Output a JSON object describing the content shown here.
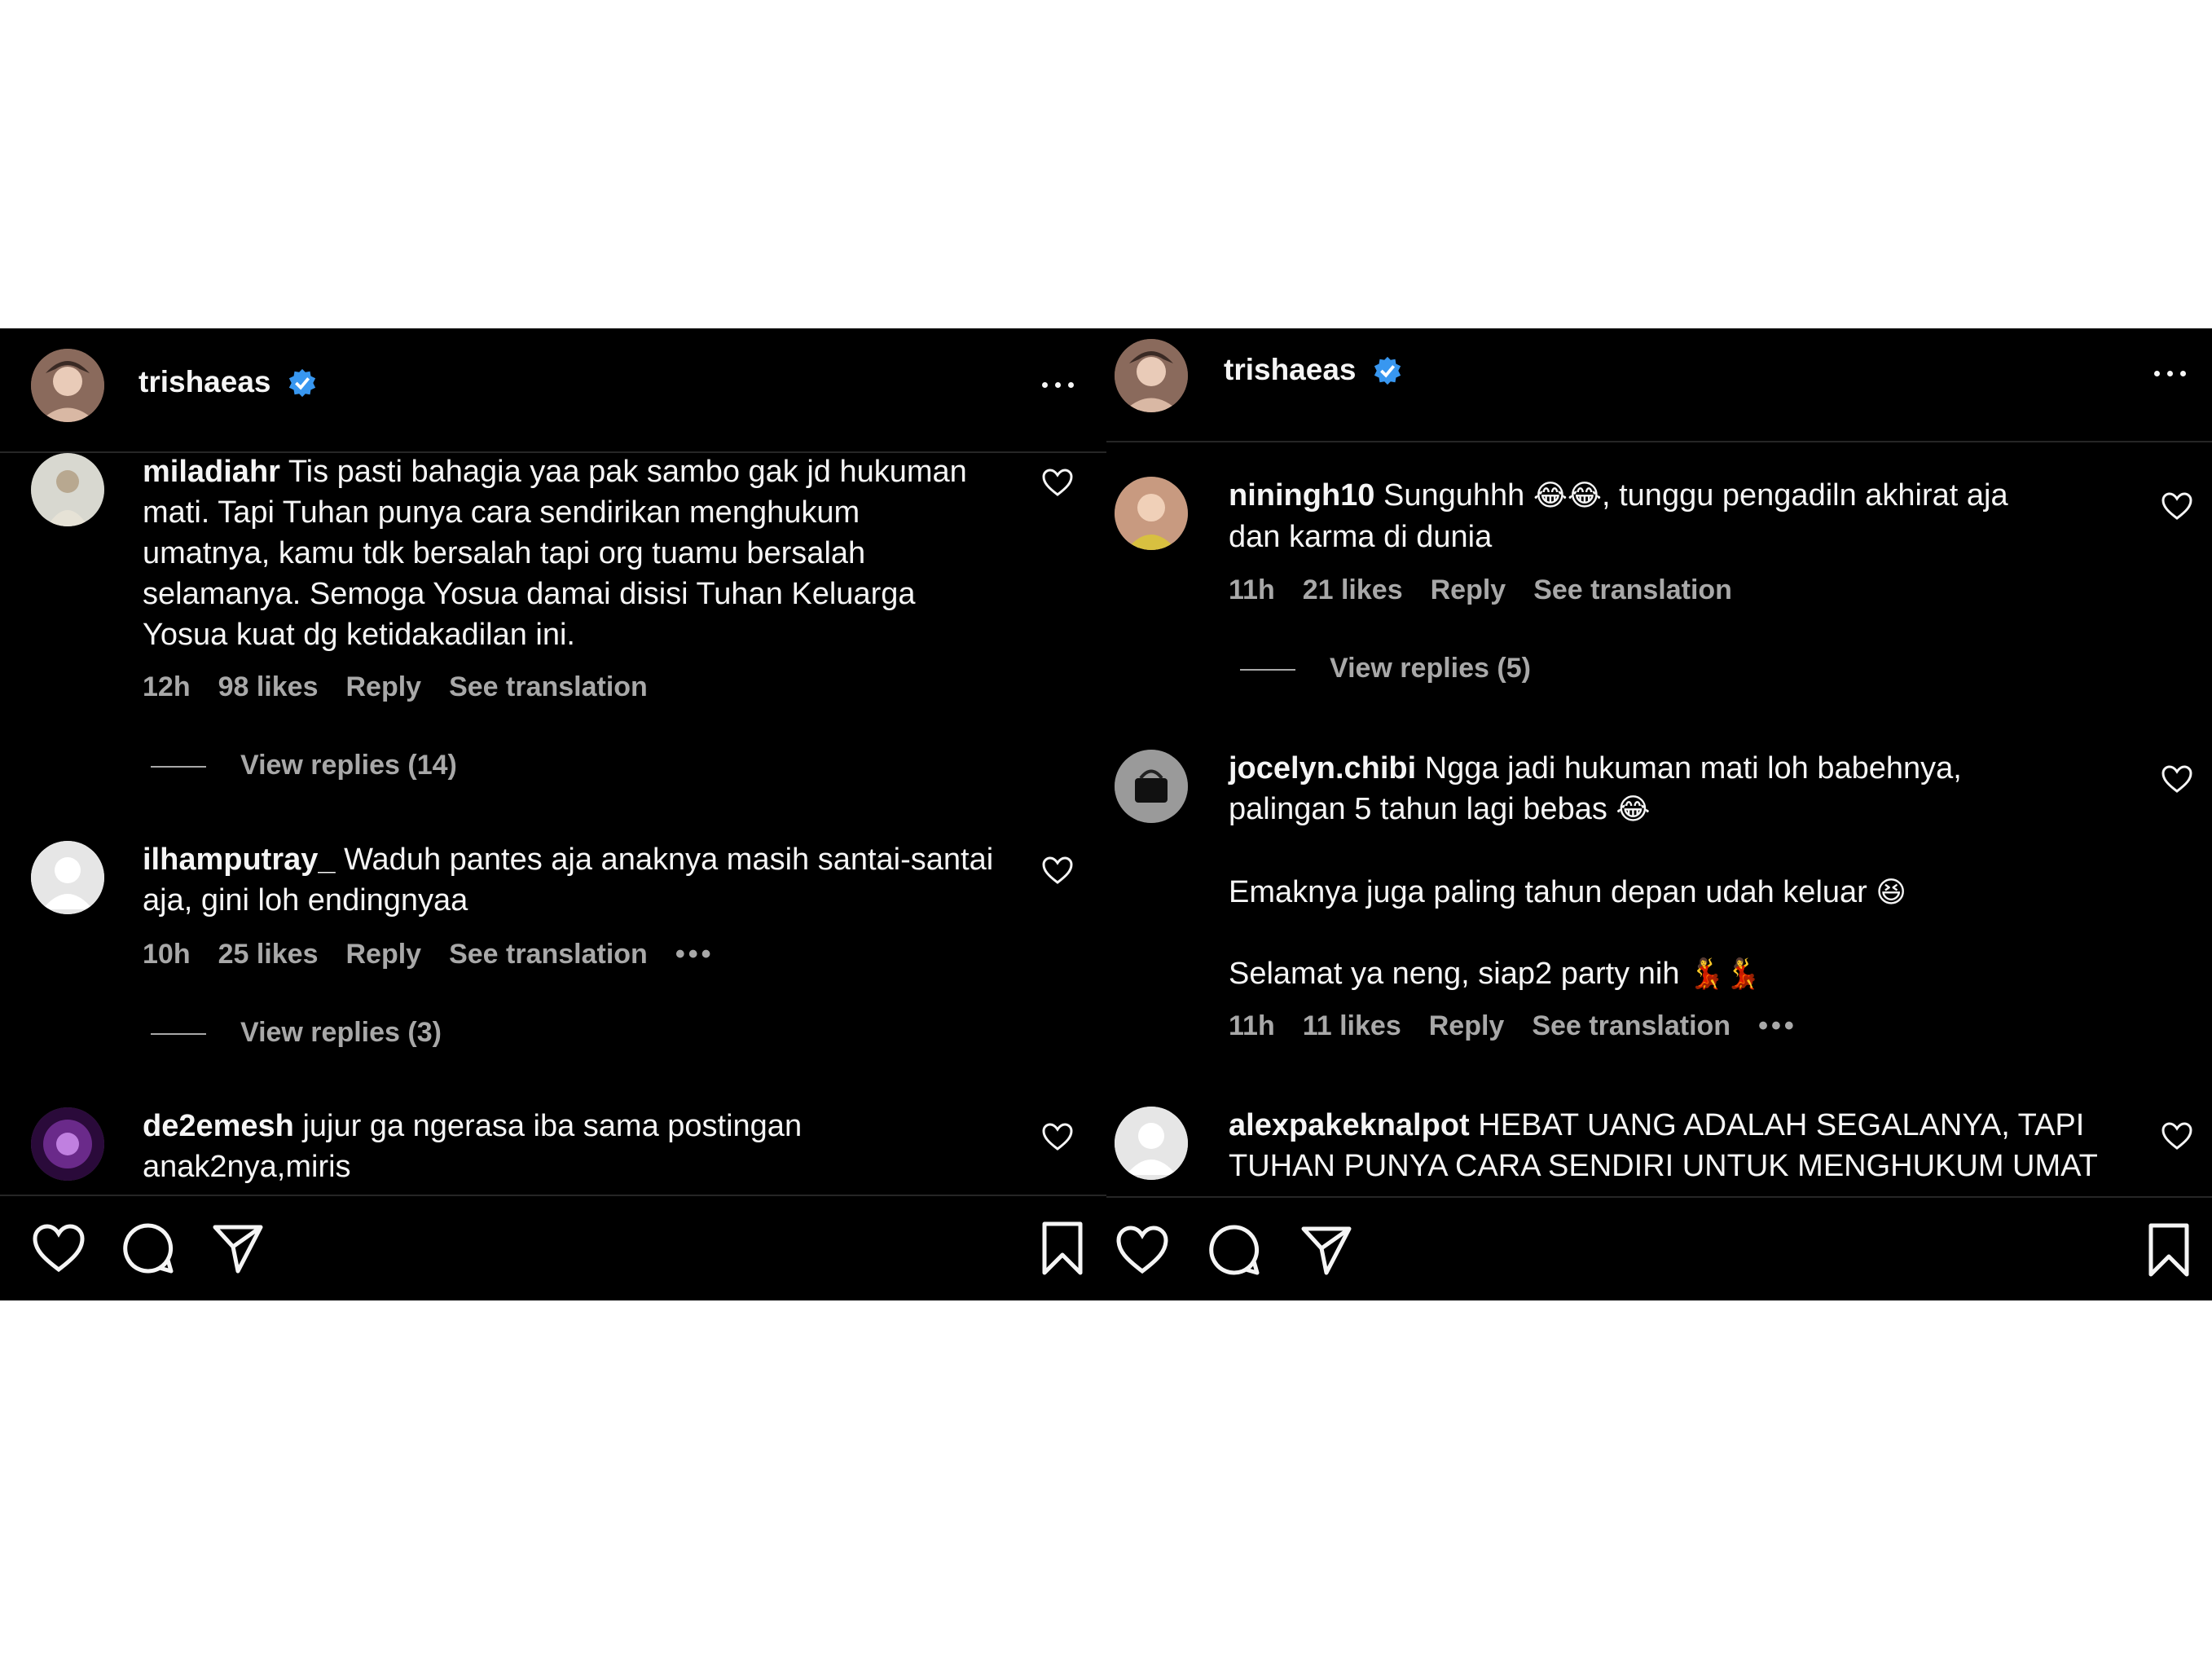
{
  "left": {
    "username": "trishaeas",
    "comments": [
      {
        "user": "miladiahr",
        "text": "Tis pasti bahagia yaa pak sambo gak jd hukuman\nmati. Tapi Tuhan punya cara sendirikan menghukum\numatnya, kamu tdk bersalah tapi org tuamu bersalah\nselamanya. Semoga Yosua damai disisi Tuhan Keluarga\nYosua kuat dg ketidakadilan ini.",
        "time": "12h",
        "likes": "98 likes",
        "reply": "Reply",
        "translate": "See translation",
        "view_replies": "View replies (14)"
      },
      {
        "user": "ilhamputray_",
        "text": "Waduh pantes aja anaknya masih santai-santai\naja, gini loh endingnyaa",
        "time": "10h",
        "likes": "25 likes",
        "reply": "Reply",
        "translate": "See translation",
        "more": "•••",
        "view_replies": "View replies (3)"
      },
      {
        "user": "de2emesh",
        "text": "jujur ga ngerasa iba sama postingan\nanak2nya,miris"
      }
    ]
  },
  "right": {
    "username": "trishaeas",
    "comments": [
      {
        "user": "niningh10",
        "text_a": "Sunguhhh ",
        "emoji_a": "😂😂",
        "text_b": ", tunggu pengadiln akhirat aja\ndan karma di dunia",
        "time": "11h",
        "likes": "21 likes",
        "reply": "Reply",
        "translate": "See translation",
        "view_replies": "View replies (5)"
      },
      {
        "user": "jocelyn.chibi",
        "text_a": "Ngga jadi hukuman mati loh babehnya,\npalingan 5 tahun lagi bebas ",
        "emoji_a": "😂",
        "text_b": "Emaknya juga paling tahun depan udah keluar ",
        "emoji_b": "😆",
        "text_c": "Selamat ya neng, siap2 party nih ",
        "emoji_c": "💃💃",
        "time": "11h",
        "likes": "11 likes",
        "reply": "Reply",
        "translate": "See translation",
        "more": "•••"
      },
      {
        "user": "alexpakeknalpot",
        "text": "HEBAT UANG ADALAH SEGALANYA, TAPI\nTUHAN PUNYA CARA SENDIRI UNTUK MENGHUKUM UMAT"
      }
    ]
  },
  "colors": {
    "background": "#000000",
    "text": "#f5f5f5",
    "muted": "#a8a8a8",
    "verified": "#3897f0"
  }
}
